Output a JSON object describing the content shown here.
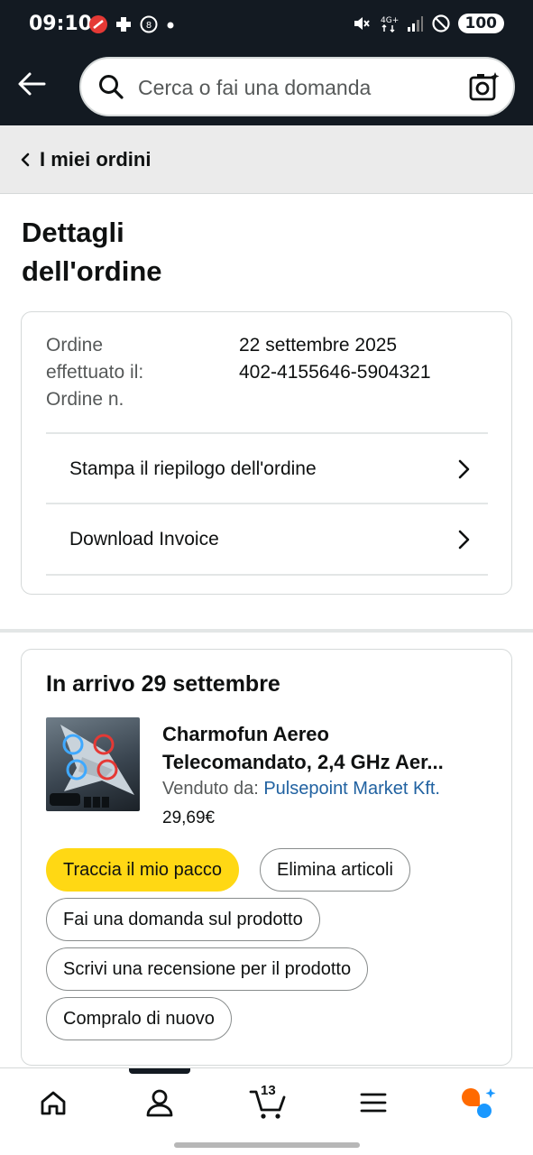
{
  "status_bar": {
    "time": "09:10",
    "network": "4G+",
    "battery": "100"
  },
  "header": {
    "search_placeholder": "Cerca o fai una domanda"
  },
  "breadcrumb": {
    "label": "I miei ordini"
  },
  "page": {
    "title_line1": "Dettagli",
    "title_line2": "dell'ordine"
  },
  "summary": {
    "placed_label_line1": "Ordine",
    "placed_label_line2": "effettuato il:",
    "placed_value": "22 settembre 2025",
    "order_number_label": "Ordine n.",
    "order_number_value": "402-4155646-5904321",
    "links": [
      {
        "label": "Stampa il riepilogo dell'ordine"
      },
      {
        "label": "Download Invoice"
      }
    ]
  },
  "shipment": {
    "title": "In arrivo 29 settembre",
    "product": {
      "title_line1": "Charmofun Aereo",
      "title_line2": "Telecomandato, 2,4 GHz Aer...",
      "seller_label": "Venduto da:",
      "seller_name": "Pulsepoint Market Kft.",
      "price": "29,69€"
    },
    "actions": {
      "track": "Traccia il mio pacco",
      "remove": "Elimina articoli",
      "ask": "Fai una domanda sul prodotto",
      "review": "Scrivi una recensione per il prodotto",
      "buy_again": "Compralo di nuovo"
    }
  },
  "bottom_nav": {
    "cart_count": "13",
    "active_tab": "account"
  },
  "colors": {
    "header_bg": "#131a22",
    "primary_button": "#ffd814",
    "link": "#2162a1",
    "assistant_orange": "#ff6a00",
    "assistant_blue": "#1a98ff"
  }
}
